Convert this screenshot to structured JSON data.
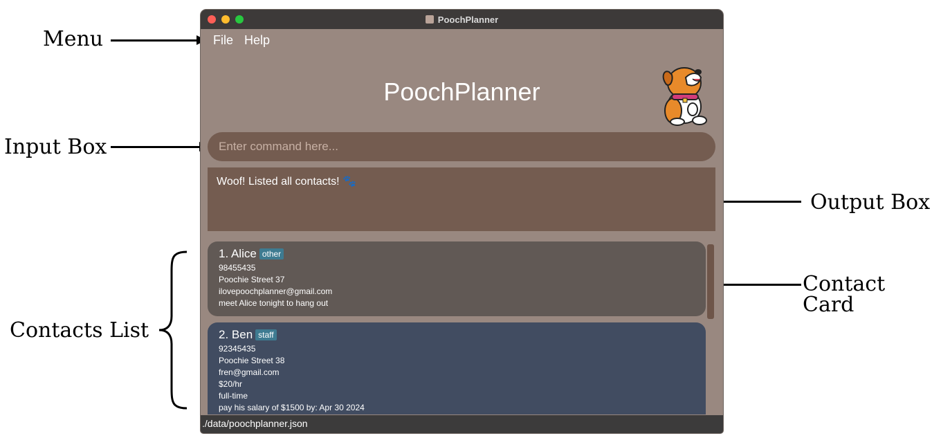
{
  "annotations": {
    "menu": "Menu",
    "input_box": "Input Box",
    "output_box": "Output Box",
    "contact_card": "Contact Card",
    "contacts_list": "Contacts List"
  },
  "window": {
    "title": "PoochPlanner",
    "menu": [
      "File",
      "Help"
    ],
    "app_title": "PoochPlanner"
  },
  "input": {
    "placeholder": "Enter command here..."
  },
  "output": {
    "text": "Woof! Listed all contacts! 🐾"
  },
  "contacts": [
    {
      "index_name": "1.  Alice",
      "tag": "other",
      "lines": [
        "98455435",
        "Poochie Street 37",
        "ilovepoochplanner@gmail.com",
        "meet Alice tonight to hang out"
      ]
    },
    {
      "index_name": "2.  Ben",
      "tag": "staff",
      "lines": [
        "92345435",
        "Poochie Street 38",
        "fren@gmail.com",
        "$20/hr",
        "full-time",
        "pay his salary of $1500 by: Apr 30 2024"
      ]
    }
  ],
  "status": {
    "path": "./data/poochplanner.json"
  },
  "colors": {
    "window_bg": "#998880",
    "box_bg": "#745c50",
    "card1_bg": "#615955",
    "card2_bg": "#414c61",
    "tag_bg": "#3e7b91"
  }
}
